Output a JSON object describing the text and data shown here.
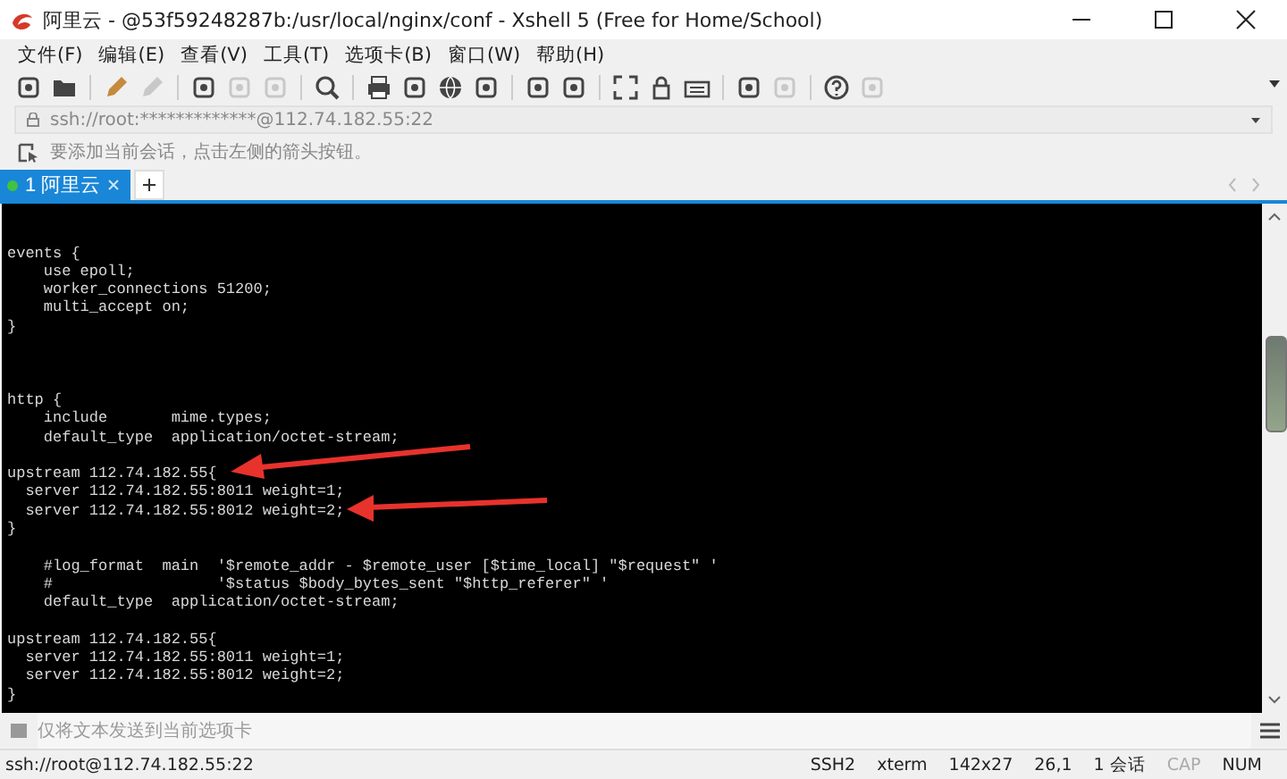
{
  "window": {
    "title": "阿里云 - @53f59248287b:/usr/local/nginx/conf - Xshell 5 (Free for Home/School)"
  },
  "menu": [
    "文件(F)",
    "编辑(E)",
    "查看(V)",
    "工具(T)",
    "选项卡(B)",
    "窗口(W)",
    "帮助(H)"
  ],
  "address_bar": {
    "value": "ssh://root:*************@112.74.182.55:22"
  },
  "hint_bar": {
    "text": "要添加当前会话，点击左侧的箭头按钮。"
  },
  "tabs": [
    {
      "label": "1 阿里云",
      "selected": true
    }
  ],
  "terminal": {
    "lines": [
      {
        "kind": "blank"
      },
      {
        "kind": "blank"
      },
      {
        "kind": "code",
        "text": "events {"
      },
      {
        "kind": "code",
        "text": "    use epoll;"
      },
      {
        "kind": "code",
        "text": "    worker_connections 51200;"
      },
      {
        "kind": "code",
        "text": "    multi_accept on;"
      },
      {
        "kind": "code",
        "text": "}"
      },
      {
        "kind": "blank"
      },
      {
        "kind": "blank"
      },
      {
        "kind": "blank"
      },
      {
        "kind": "code",
        "text": "http {"
      },
      {
        "kind": "code",
        "text": "    include       mime.types;"
      },
      {
        "kind": "code",
        "text": "    default_type  application/octet-stream;"
      },
      {
        "kind": "blank"
      },
      {
        "kind": "code",
        "text": "upstream 112.74.182.55{"
      },
      {
        "kind": "code",
        "text": "  server 112.74.182.55:8011 weight=1;"
      },
      {
        "kind": "code",
        "text": "  server 112.74.182.55:8012 weight=2;"
      },
      {
        "kind": "code",
        "text": "}"
      },
      {
        "kind": "blank"
      },
      {
        "kind": "code",
        "text": "    #log_format  main  '$remote_addr - $remote_user [$time_local] \"$request\" '"
      },
      {
        "kind": "code",
        "text": "    #                  '$status $body_bytes_sent \"$http_referer\" '"
      },
      {
        "kind": "code",
        "text": "    default_type  application/octet-stream;"
      },
      {
        "kind": "blank"
      },
      {
        "kind": "code",
        "text": "upstream 112.74.182.55{"
      },
      {
        "kind": "code",
        "text": "  server 112.74.182.55:8011 weight=1;"
      },
      {
        "kind": "code",
        "text": "  server 112.74.182.55:8012 weight=2;"
      },
      {
        "kind": "code",
        "text": "}"
      }
    ]
  },
  "compose_bar": {
    "placeholder": "仅将文本发送到当前选项卡"
  },
  "status_bar": {
    "connection": "ssh://root@112.74.182.55:22",
    "items": [
      "SSH2",
      "xterm",
      "142x27",
      "26,1",
      "1 会话",
      "CAP",
      "NUM"
    ]
  }
}
